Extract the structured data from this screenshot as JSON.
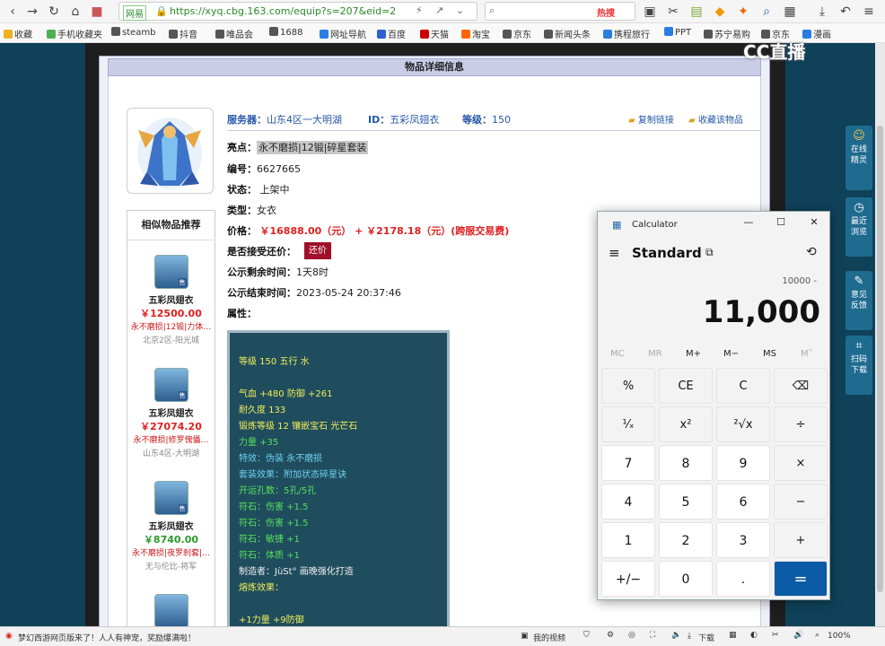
{
  "browser": {
    "tab_label": "网易",
    "url": "https://xyq.cbg.163.com/equip?s=207&eid=2",
    "search_hot": "热搜",
    "zoom": "100%"
  },
  "bookmarks": [
    {
      "label": "收藏",
      "color": "#f0b020"
    },
    {
      "label": "手机收藏夹",
      "color": "#4caf50"
    },
    {
      "label": "steamb",
      "color": "#555"
    },
    {
      "label": "抖音",
      "color": "#555"
    },
    {
      "label": "唯品会",
      "color": "#555"
    },
    {
      "label": "1688",
      "color": "#555"
    },
    {
      "label": "网址导航",
      "color": "#2a7de1"
    },
    {
      "label": "百度",
      "color": "#3060d0"
    },
    {
      "label": "天猫",
      "color": "#c00"
    },
    {
      "label": "淘宝",
      "color": "#f60"
    },
    {
      "label": "京东",
      "color": "#555"
    },
    {
      "label": "新闻头条",
      "color": "#555"
    },
    {
      "label": "携程旅行",
      "color": "#2a7de1"
    },
    {
      "label": "PPT",
      "color": "#2a7de1"
    },
    {
      "label": "苏宁易购",
      "color": "#555"
    },
    {
      "label": "京东",
      "color": "#555"
    },
    {
      "label": "漫画",
      "color": "#2a7de1"
    }
  ],
  "detail": {
    "header": "物品详细信息",
    "server_label": "服务器：",
    "server_value": "山东4区一大明湖",
    "id_label": "ID：",
    "id_value": "五彩凤翅衣",
    "level_label": "等级：",
    "level_value": "150",
    "copy_link": "复制链接",
    "favorite": "收藏该物品",
    "highlight_label": "亮点：",
    "highlight_value": "永不磨损|12锻|碎星套装",
    "number_label": "编号：",
    "number_value": "6627665",
    "status_label": "状态：",
    "status_value": "上架中",
    "type_label": "类型：",
    "type_value": "女衣",
    "price_label": "价格：",
    "price_value": "￥16888.00（元） + ￥2178.18（元）(跨服交易费)",
    "bargain_label": "是否接受还价：",
    "bargain_button": "还价",
    "remaining_label": "公示剩余时间：",
    "remaining_value": "1天8时",
    "end_label": "公示结束时间：",
    "end_value": "2023-05-24 20:37:46",
    "attr_label": "属性："
  },
  "similar": {
    "title": "相似物品推荐",
    "items": [
      {
        "name": "五彩凤翅衣",
        "price": "￥12500.00",
        "price_color": "red",
        "tags": "永不磨损|12锻|力体…",
        "server": "北京2区-阳光城"
      },
      {
        "name": "五彩凤翅衣",
        "price": "￥27074.20",
        "price_color": "red",
        "tags": "永不磨损|修罗傀儡…",
        "server": "山东4区-大明湖"
      },
      {
        "name": "五彩凤翅衣",
        "price": "￥8740.00",
        "price_color": "green",
        "tags": "永不磨损|夜罗刹套|…",
        "server": "无与伦比-将军"
      }
    ],
    "badge": "售"
  },
  "attributes": [
    {
      "text": "等级 150  五行 水",
      "color": "yel"
    },
    {
      "text": "",
      "color": "wht"
    },
    {
      "text": "气血 +480 防御 +261",
      "color": "yel"
    },
    {
      "text": "耐久度 133",
      "color": "yel"
    },
    {
      "text": "锻炼等级 12  镶嵌宝石 光芒石",
      "color": "yel"
    },
    {
      "text": "力量 +35",
      "color": "grn"
    },
    {
      "text": "特效：伪装 永不磨损",
      "color": "cyan"
    },
    {
      "text": "套装效果：附加状态碎星诀",
      "color": "cyan"
    },
    {
      "text": "开运孔数：5孔/5孔",
      "color": "grn"
    },
    {
      "text": "符石：伤害 +1.5",
      "color": "grn"
    },
    {
      "text": "符石：伤害 +1.5",
      "color": "grn"
    },
    {
      "text": "符石：敏捷 +1",
      "color": "grn"
    },
    {
      "text": "符石：体质 +1",
      "color": "grn"
    },
    {
      "text": "制造者：JùSt° 画晚强化打造",
      "color": "wht"
    },
    {
      "text": "熔炼效果：",
      "color": "yel"
    },
    {
      "text": "",
      "color": "wht"
    },
    {
      "text": "+1力量 +9防御",
      "color": "yel"
    }
  ],
  "sidebar": [
    {
      "label": "在线精灵",
      "icon": "smile-icon"
    },
    {
      "label": "最近浏览",
      "icon": "clock-icon"
    },
    {
      "label": "意见反馈",
      "icon": "edit-icon"
    },
    {
      "label": "扫码下载",
      "icon": "scan-icon"
    }
  ],
  "watermark": "CC直播",
  "calculator": {
    "title": "Calculator",
    "mode": "Standard",
    "expression": "10000 -",
    "display": "11,000",
    "memory": [
      "MC",
      "MR",
      "M+",
      "M−",
      "MS",
      "M˅"
    ],
    "keys": [
      [
        "%",
        "CE",
        "C",
        "⌫"
      ],
      [
        "¹⁄ₓ",
        "x²",
        "²√x",
        "÷"
      ],
      [
        "7",
        "8",
        "9",
        "×"
      ],
      [
        "4",
        "5",
        "6",
        "−"
      ],
      [
        "1",
        "2",
        "3",
        "+"
      ],
      [
        "+/−",
        "0",
        ".",
        "="
      ]
    ]
  },
  "statusbar": {
    "left": "梦幻西游网页版来了！人人有神宠，奖励爆满啦！",
    "videos": "我的视频",
    "download": "下载",
    "zoom": "100%"
  }
}
